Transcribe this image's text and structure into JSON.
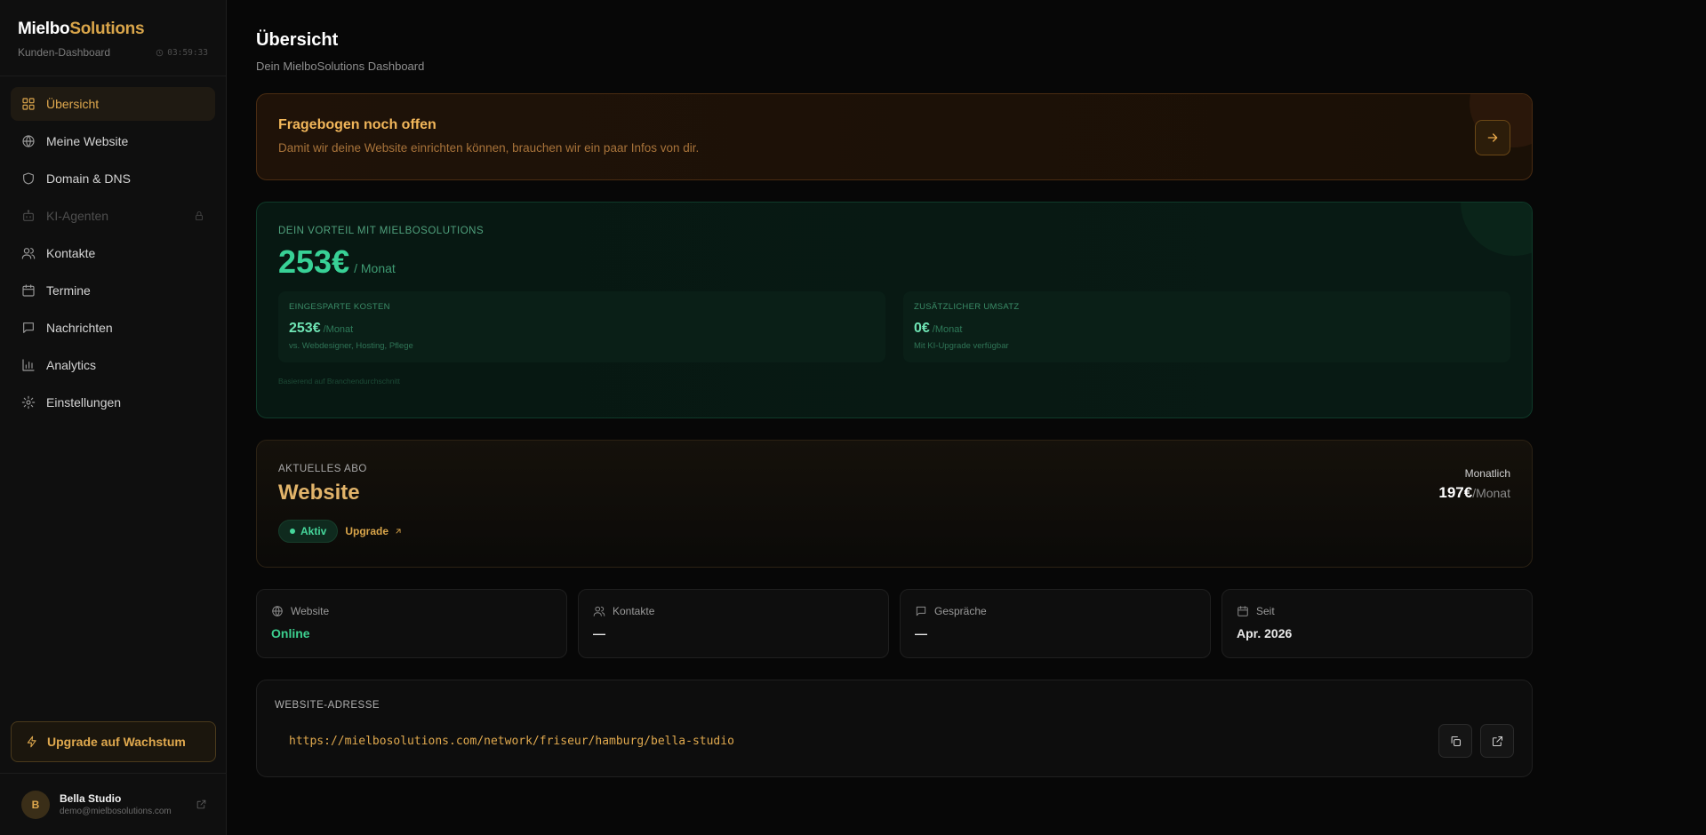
{
  "brand": {
    "name_part1": "Mielbo",
    "name_part2": "Solutions",
    "subtitle": "Kunden-Dashboard",
    "clock": "03:59:33"
  },
  "sidebar": {
    "items": [
      {
        "label": "Übersicht",
        "icon": "grid-icon"
      },
      {
        "label": "Meine Website",
        "icon": "globe-icon"
      },
      {
        "label": "Domain & DNS",
        "icon": "shield-icon"
      },
      {
        "label": "KI-Agenten",
        "icon": "bot-icon"
      },
      {
        "label": "Kontakte",
        "icon": "users-icon"
      },
      {
        "label": "Termine",
        "icon": "calendar-icon"
      },
      {
        "label": "Nachrichten",
        "icon": "message-icon"
      },
      {
        "label": "Analytics",
        "icon": "bar-chart-icon"
      },
      {
        "label": "Einstellungen",
        "icon": "gear-icon"
      }
    ],
    "upgrade_label": "Upgrade auf Wachstum"
  },
  "user": {
    "initial": "B",
    "name": "Bella Studio",
    "email": "demo@mielbosolutions.com"
  },
  "header": {
    "title": "Übersicht",
    "subtitle": "Dein MielboSolutions Dashboard"
  },
  "alert": {
    "title": "Fragebogen noch offen",
    "text": "Damit wir deine Website einrichten können, brauchen wir ein paar Infos von dir."
  },
  "vorteil": {
    "label": "Dein Vorteil mit MielboSolutions",
    "amount": "253€",
    "per": "/ Monat",
    "boxes": [
      {
        "label": "Eingesparte Kosten",
        "value": "253€",
        "per": "/Monat",
        "note": "vs. Webdesigner, Hosting, Pflege"
      },
      {
        "label": "Zusätzlicher Umsatz",
        "value": "0€",
        "per": "/Monat",
        "note": "Mit KI-Upgrade verfügbar"
      }
    ],
    "footnote": "Basierend auf Branchendurchschnitt"
  },
  "abo": {
    "label": "Aktuelles Abo",
    "name": "Website",
    "status": "Aktiv",
    "upgrade": "Upgrade",
    "frequency": "Monatlich",
    "price": "197€",
    "price_per": "/Monat"
  },
  "stats": [
    {
      "label": "Website",
      "value": "Online",
      "icon": "globe-icon"
    },
    {
      "label": "Kontakte",
      "value": "—",
      "icon": "users-icon"
    },
    {
      "label": "Gespräche",
      "value": "—",
      "icon": "message-icon"
    },
    {
      "label": "Seit",
      "value": "Apr. 2026",
      "icon": "calendar-icon"
    }
  ],
  "address": {
    "label": "Website-Adresse",
    "url": "https://mielbosolutions.com/network/friseur/hamburg/bella-studio"
  },
  "colors": {
    "accent": "#e0a94e",
    "success": "#38d196",
    "background": "#070707"
  }
}
